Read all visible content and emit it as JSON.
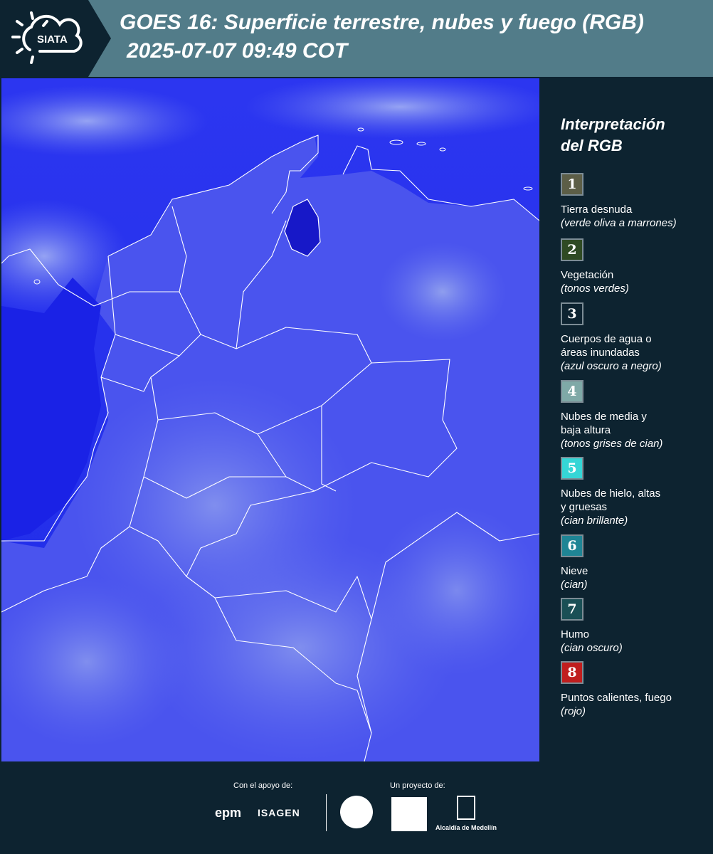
{
  "header": {
    "logo_text": "SIATA",
    "title": "GOES 16: Superficie terrestre, nubes y fuego (RGB)",
    "subtitle": "2025-07-07 09:49 COT"
  },
  "legend": {
    "title_line1": "Interpretación",
    "title_line2": "del RGB",
    "items": [
      {
        "num": "1",
        "color": "#5c5e47",
        "label": "Tierra desnuda",
        "note": "(verde oliva a marrones)"
      },
      {
        "num": "2",
        "color": "#2f4a23",
        "label": "Vegetación",
        "note": "(tonos verdes)"
      },
      {
        "num": "3",
        "color": "#0d2330",
        "label": "Cuerpos de agua o áreas inundadas",
        "note": "(azul oscuro a negro)"
      },
      {
        "num": "4",
        "color": "#7fa9a7",
        "label": "Nubes de media y baja altura",
        "note": "(tonos grises de cian)"
      },
      {
        "num": "5",
        "color": "#35d6d6",
        "label": "Nubes de hielo, altas y gruesas",
        "note": "(cian brillante)"
      },
      {
        "num": "6",
        "color": "#1f8595",
        "label": "Nieve",
        "note": "(cian)"
      },
      {
        "num": "7",
        "color": "#1a4f55",
        "label": "Humo",
        "note": "(cian oscuro)"
      },
      {
        "num": "8",
        "color": "#c01e1e",
        "label": "Puntos calientes, fuego",
        "note": "(rojo)"
      }
    ]
  },
  "footer": {
    "support_label": "Con el apoyo de:",
    "project_label": "Un proyecto de:",
    "sponsors": [
      "epm",
      "ISAGEN"
    ],
    "partner_label": "Alcaldía de Medellín"
  },
  "colors": {
    "header_bg": "#527c89",
    "panel_bg": "#0d2330",
    "map_ocean": "#2323ee",
    "map_land": "#4a56ee",
    "map_clouds": "#8fa3f2"
  }
}
